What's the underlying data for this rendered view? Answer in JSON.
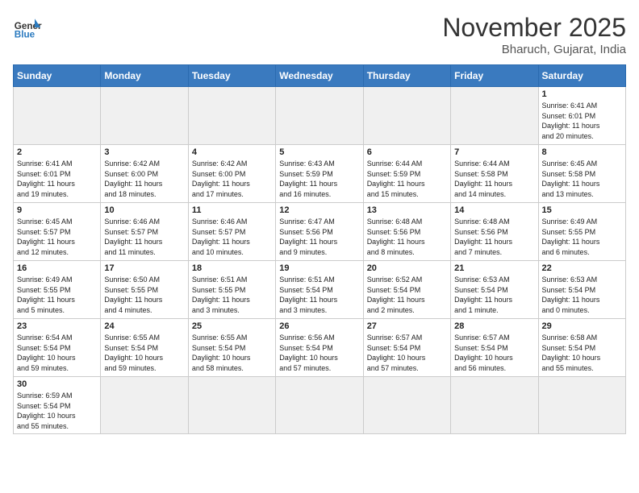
{
  "header": {
    "logo_general": "General",
    "logo_blue": "Blue",
    "month_year": "November 2025",
    "location": "Bharuch, Gujarat, India"
  },
  "weekdays": [
    "Sunday",
    "Monday",
    "Tuesday",
    "Wednesday",
    "Thursday",
    "Friday",
    "Saturday"
  ],
  "weeks": [
    [
      {
        "day": "",
        "info": "",
        "empty": true
      },
      {
        "day": "",
        "info": "",
        "empty": true
      },
      {
        "day": "",
        "info": "",
        "empty": true
      },
      {
        "day": "",
        "info": "",
        "empty": true
      },
      {
        "day": "",
        "info": "",
        "empty": true
      },
      {
        "day": "",
        "info": "",
        "empty": true
      },
      {
        "day": "1",
        "info": "Sunrise: 6:41 AM\nSunset: 6:01 PM\nDaylight: 11 hours\nand 20 minutes."
      }
    ],
    [
      {
        "day": "2",
        "info": "Sunrise: 6:41 AM\nSunset: 6:01 PM\nDaylight: 11 hours\nand 19 minutes."
      },
      {
        "day": "3",
        "info": "Sunrise: 6:42 AM\nSunset: 6:00 PM\nDaylight: 11 hours\nand 18 minutes."
      },
      {
        "day": "4",
        "info": "Sunrise: 6:42 AM\nSunset: 6:00 PM\nDaylight: 11 hours\nand 17 minutes."
      },
      {
        "day": "5",
        "info": "Sunrise: 6:43 AM\nSunset: 5:59 PM\nDaylight: 11 hours\nand 16 minutes."
      },
      {
        "day": "6",
        "info": "Sunrise: 6:44 AM\nSunset: 5:59 PM\nDaylight: 11 hours\nand 15 minutes."
      },
      {
        "day": "7",
        "info": "Sunrise: 6:44 AM\nSunset: 5:58 PM\nDaylight: 11 hours\nand 14 minutes."
      },
      {
        "day": "8",
        "info": "Sunrise: 6:45 AM\nSunset: 5:58 PM\nDaylight: 11 hours\nand 13 minutes."
      }
    ],
    [
      {
        "day": "9",
        "info": "Sunrise: 6:45 AM\nSunset: 5:57 PM\nDaylight: 11 hours\nand 12 minutes."
      },
      {
        "day": "10",
        "info": "Sunrise: 6:46 AM\nSunset: 5:57 PM\nDaylight: 11 hours\nand 11 minutes."
      },
      {
        "day": "11",
        "info": "Sunrise: 6:46 AM\nSunset: 5:57 PM\nDaylight: 11 hours\nand 10 minutes."
      },
      {
        "day": "12",
        "info": "Sunrise: 6:47 AM\nSunset: 5:56 PM\nDaylight: 11 hours\nand 9 minutes."
      },
      {
        "day": "13",
        "info": "Sunrise: 6:48 AM\nSunset: 5:56 PM\nDaylight: 11 hours\nand 8 minutes."
      },
      {
        "day": "14",
        "info": "Sunrise: 6:48 AM\nSunset: 5:56 PM\nDaylight: 11 hours\nand 7 minutes."
      },
      {
        "day": "15",
        "info": "Sunrise: 6:49 AM\nSunset: 5:55 PM\nDaylight: 11 hours\nand 6 minutes."
      }
    ],
    [
      {
        "day": "16",
        "info": "Sunrise: 6:49 AM\nSunset: 5:55 PM\nDaylight: 11 hours\nand 5 minutes."
      },
      {
        "day": "17",
        "info": "Sunrise: 6:50 AM\nSunset: 5:55 PM\nDaylight: 11 hours\nand 4 minutes."
      },
      {
        "day": "18",
        "info": "Sunrise: 6:51 AM\nSunset: 5:55 PM\nDaylight: 11 hours\nand 3 minutes."
      },
      {
        "day": "19",
        "info": "Sunrise: 6:51 AM\nSunset: 5:54 PM\nDaylight: 11 hours\nand 3 minutes."
      },
      {
        "day": "20",
        "info": "Sunrise: 6:52 AM\nSunset: 5:54 PM\nDaylight: 11 hours\nand 2 minutes."
      },
      {
        "day": "21",
        "info": "Sunrise: 6:53 AM\nSunset: 5:54 PM\nDaylight: 11 hours\nand 1 minute."
      },
      {
        "day": "22",
        "info": "Sunrise: 6:53 AM\nSunset: 5:54 PM\nDaylight: 11 hours\nand 0 minutes."
      }
    ],
    [
      {
        "day": "23",
        "info": "Sunrise: 6:54 AM\nSunset: 5:54 PM\nDaylight: 10 hours\nand 59 minutes."
      },
      {
        "day": "24",
        "info": "Sunrise: 6:55 AM\nSunset: 5:54 PM\nDaylight: 10 hours\nand 59 minutes."
      },
      {
        "day": "25",
        "info": "Sunrise: 6:55 AM\nSunset: 5:54 PM\nDaylight: 10 hours\nand 58 minutes."
      },
      {
        "day": "26",
        "info": "Sunrise: 6:56 AM\nSunset: 5:54 PM\nDaylight: 10 hours\nand 57 minutes."
      },
      {
        "day": "27",
        "info": "Sunrise: 6:57 AM\nSunset: 5:54 PM\nDaylight: 10 hours\nand 57 minutes."
      },
      {
        "day": "28",
        "info": "Sunrise: 6:57 AM\nSunset: 5:54 PM\nDaylight: 10 hours\nand 56 minutes."
      },
      {
        "day": "29",
        "info": "Sunrise: 6:58 AM\nSunset: 5:54 PM\nDaylight: 10 hours\nand 55 minutes."
      }
    ],
    [
      {
        "day": "30",
        "info": "Sunrise: 6:59 AM\nSunset: 5:54 PM\nDaylight: 10 hours\nand 55 minutes.",
        "last": true
      },
      {
        "day": "",
        "info": "",
        "empty": true,
        "last": true
      },
      {
        "day": "",
        "info": "",
        "empty": true,
        "last": true
      },
      {
        "day": "",
        "info": "",
        "empty": true,
        "last": true
      },
      {
        "day": "",
        "info": "",
        "empty": true,
        "last": true
      },
      {
        "day": "",
        "info": "",
        "empty": true,
        "last": true
      },
      {
        "day": "",
        "info": "",
        "empty": true,
        "last": true
      }
    ]
  ]
}
